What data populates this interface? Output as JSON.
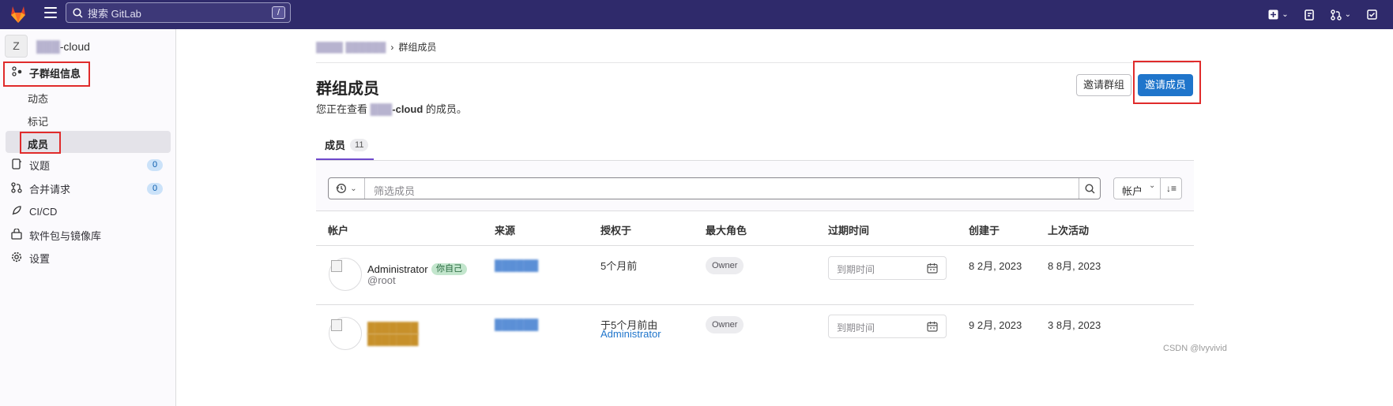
{
  "topbar": {
    "search_placeholder": "搜索 GitLab",
    "search_shortcut": "/"
  },
  "sidebar": {
    "group_avatar_letter": "Z",
    "group_name": "   -cloud",
    "items": [
      {
        "label": "子群组信息",
        "icon": "group-icon"
      },
      {
        "label": "动态"
      },
      {
        "label": "标记"
      },
      {
        "label": "成员"
      },
      {
        "label": "议题",
        "icon": "issues-icon",
        "count": "0"
      },
      {
        "label": "合并请求",
        "icon": "merge-request-icon",
        "count": "0"
      },
      {
        "label": "CI/CD",
        "icon": "rocket-icon"
      },
      {
        "label": "软件包与镜像库",
        "icon": "package-icon"
      },
      {
        "label": "设置",
        "icon": "gear-icon"
      }
    ]
  },
  "breadcrumb": {
    "current": "群组成员"
  },
  "page": {
    "title": "群组成员",
    "subtitle_prefix": "您正在查看 ",
    "subtitle_group": "-cloud",
    "subtitle_suffix": " 的成员。",
    "invite_group": "邀请群组",
    "invite_member": "邀请成员"
  },
  "tabs": [
    {
      "label": "成员",
      "count": "11"
    }
  ],
  "filter": {
    "placeholder": "筛选成员",
    "sort_label": "帐户"
  },
  "table": {
    "headers": [
      "帐户",
      "来源",
      "授权于",
      "最大角色",
      "过期时间",
      "创建于",
      "上次活动"
    ],
    "rows": [
      {
        "name": "Administrator",
        "you_badge": "你自己",
        "handle": "@root",
        "granted": "5个月前",
        "granted_by": "",
        "role": "Owner",
        "expiry_placeholder": "到期时间",
        "created": "8 2月, 2023",
        "last_activity": "8 8月, 2023"
      },
      {
        "name": "",
        "you_badge": "",
        "handle": "",
        "granted": "于5个月前由",
        "granted_by": "Administrator",
        "role": "Owner",
        "expiry_placeholder": "到期时间",
        "created": "9 2月, 2023",
        "last_activity": "3 8月, 2023"
      }
    ]
  },
  "watermark": "CSDN @lvyvivid",
  "colors": {
    "topbar": "#2f2a6b",
    "primary_button": "#1f75cb",
    "tab_underline": "#6e49cb",
    "highlight_box": "#e02b2b"
  }
}
